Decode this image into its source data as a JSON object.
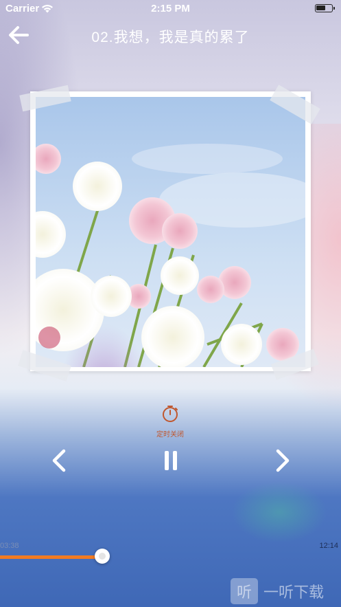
{
  "status_bar": {
    "carrier": "Carrier",
    "time": "2:15 PM"
  },
  "header": {
    "title": "02.我想，我是真的累了",
    "back_icon": "back-arrow-icon"
  },
  "timer": {
    "label": "定时关闭",
    "icon": "stopwatch-icon",
    "color": "#c0572e"
  },
  "controls": {
    "prev_icon": "chevron-left-icon",
    "play_pause_icon": "pause-icon",
    "next_icon": "chevron-right-icon"
  },
  "progress": {
    "elapsed": "03:38",
    "total": "12:14",
    "played_fraction": 0.3,
    "accent": "#f27b22"
  },
  "watermark": {
    "glyph": "听",
    "text": "一听下载"
  }
}
